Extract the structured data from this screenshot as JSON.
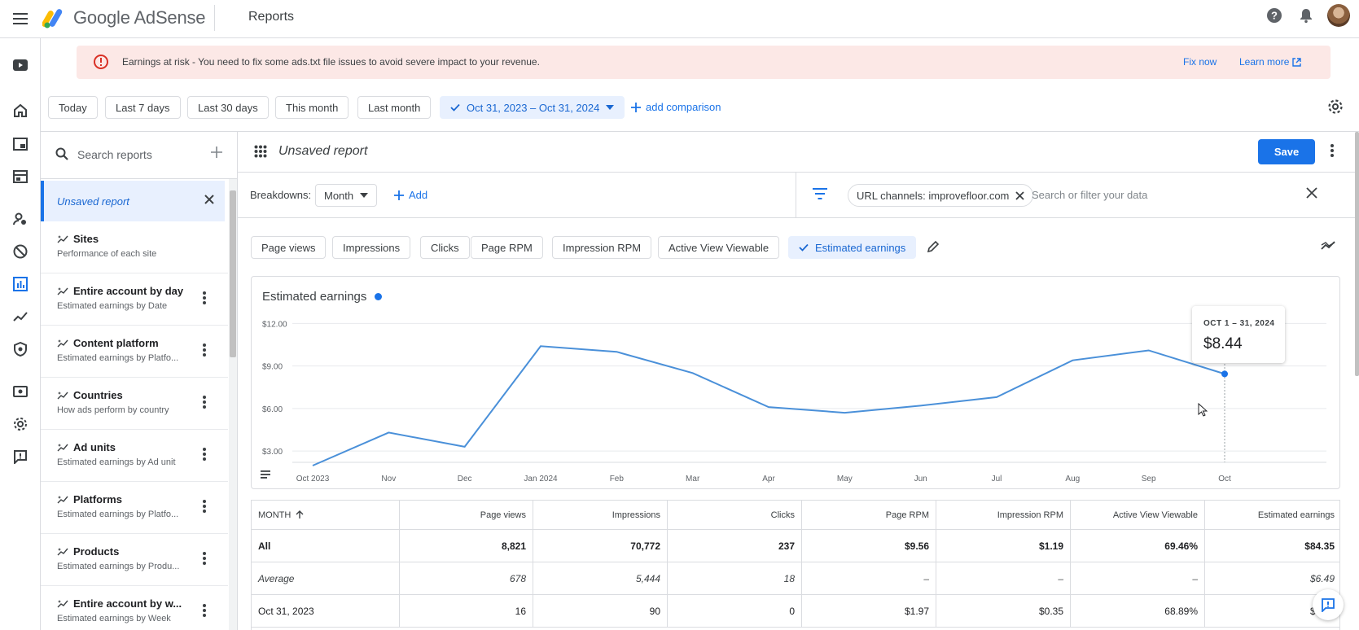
{
  "header": {
    "brand": "Google AdSense",
    "page_title": "Reports"
  },
  "alert": {
    "text": "Earnings at risk - You need to fix some ads.txt file issues to avoid severe impact to your revenue.",
    "fix_label": "Fix now",
    "learn_label": "Learn more"
  },
  "date_range": {
    "chips": [
      "Today",
      "Last 7 days",
      "Last 30 days",
      "This month",
      "Last month"
    ],
    "selected": "Oct 31, 2023 – Oct 31, 2024",
    "add_comparison": "add comparison"
  },
  "sidebar": {
    "search_placeholder": "Search reports",
    "current": "Unsaved report",
    "items": [
      {
        "title": "Sites",
        "subtitle": "Performance of each site"
      },
      {
        "title": "Entire account by day",
        "subtitle": "Estimated earnings by Date"
      },
      {
        "title": "Content platform",
        "subtitle": "Estimated earnings by Platfo..."
      },
      {
        "title": "Countries",
        "subtitle": "How ads perform by country"
      },
      {
        "title": "Ad units",
        "subtitle": "Estimated earnings by Ad unit"
      },
      {
        "title": "Platforms",
        "subtitle": "Estimated earnings by Platfo..."
      },
      {
        "title": "Products",
        "subtitle": "Estimated earnings by Produ..."
      },
      {
        "title": "Entire account by w...",
        "subtitle": "Estimated earnings by Week"
      }
    ]
  },
  "report": {
    "title": "Unsaved report",
    "save_label": "Save",
    "breakdowns_label": "Breakdowns:",
    "breakdown_value": "Month",
    "add_label": "Add",
    "filter_chip": "URL channels: improvefloor.com",
    "filter_placeholder": "Search or filter your data",
    "metrics": [
      "Page views",
      "Impressions",
      "Clicks",
      "Page RPM",
      "Impression RPM",
      "Active View Viewable",
      "Estimated earnings"
    ],
    "selected_metric": "Estimated earnings"
  },
  "chart_data": {
    "type": "line",
    "title": "Estimated earnings",
    "x": [
      "Oct 2023",
      "Nov",
      "Dec",
      "Jan 2024",
      "Feb",
      "Mar",
      "Apr",
      "May",
      "Jun",
      "Jul",
      "Aug",
      "Sep",
      "Oct"
    ],
    "series": [
      {
        "values": [
          1.97,
          4.3,
          3.3,
          10.4,
          10.0,
          8.5,
          6.1,
          5.7,
          6.2,
          6.8,
          9.4,
          10.1,
          8.44
        ]
      }
    ],
    "yticks": [
      "$3.00",
      "$6.00",
      "$9.00",
      "$12.00"
    ],
    "ylim": [
      2.2,
      13
    ],
    "grid": true,
    "color": "#4a90d9",
    "tooltip": {
      "date": "OCT 1 – 31, 2024",
      "value": "$8.44"
    }
  },
  "table": {
    "headers": [
      "MONTH",
      "Page views",
      "Impressions",
      "Clicks",
      "Page RPM",
      "Impression RPM",
      "Active View Viewable",
      "Estimated earnings"
    ],
    "rows": [
      [
        "All",
        "8,821",
        "70,772",
        "237",
        "$9.56",
        "$1.19",
        "69.46%",
        "$84.35"
      ],
      [
        "Average",
        "678",
        "5,444",
        "18",
        "–",
        "–",
        "–",
        "$6.49"
      ],
      [
        "Oct 31, 2023",
        "16",
        "90",
        "0",
        "$1.97",
        "$0.35",
        "68.89%",
        "$0.03"
      ]
    ]
  }
}
